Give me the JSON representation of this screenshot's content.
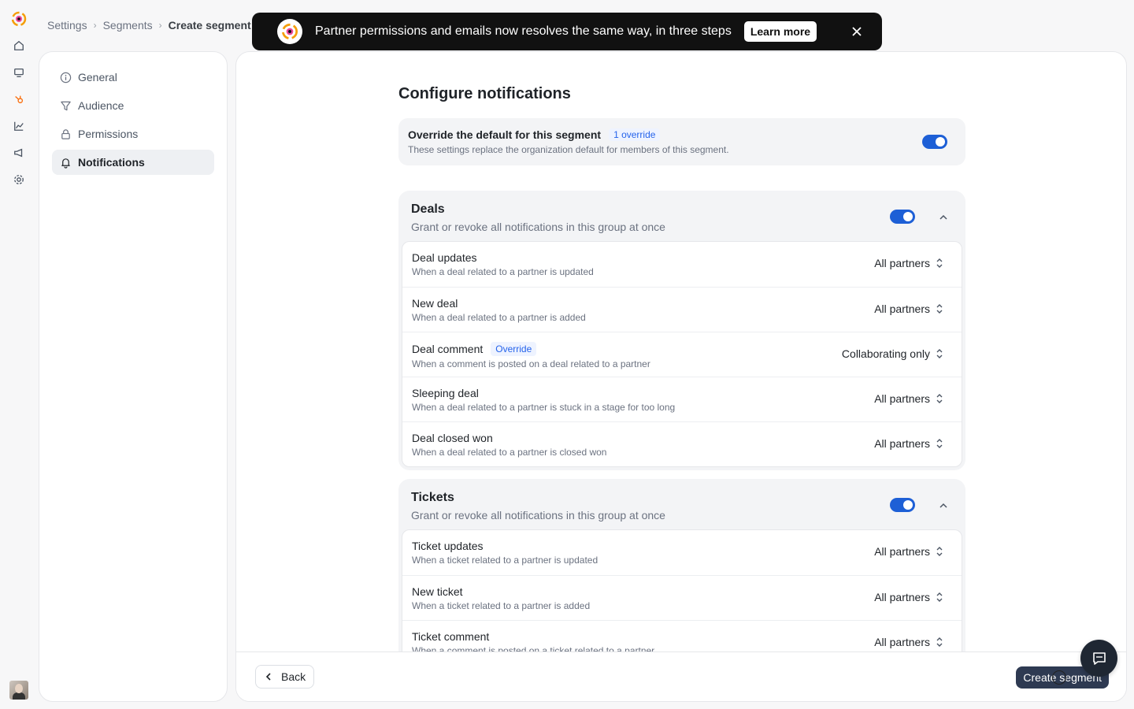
{
  "breadcrumb": {
    "items": [
      "Settings",
      "Segments"
    ],
    "current": "Create segment"
  },
  "banner": {
    "text": "Partner permissions and emails now resolves the same way, in three steps",
    "learn_more": "Learn more"
  },
  "sidenav": {
    "items": [
      {
        "label": "General",
        "icon": "info-icon"
      },
      {
        "label": "Audience",
        "icon": "filter-icon"
      },
      {
        "label": "Permissions",
        "icon": "lock-icon"
      },
      {
        "label": "Notifications",
        "icon": "bell-icon",
        "active": true
      }
    ]
  },
  "main": {
    "title": "Configure notifications",
    "override": {
      "title": "Override the default for this segment",
      "badge": "1 override",
      "description": "These settings replace the organization default for members of this segment.",
      "enabled": true
    },
    "groups": [
      {
        "title": "Deals",
        "subtitle": "Grant or revoke all notifications in this group at once",
        "enabled": true,
        "items": [
          {
            "title": "Deal updates",
            "desc": "When a deal related to a partner is updated",
            "value": "All partners"
          },
          {
            "title": "New deal",
            "desc": "When a deal related to a partner is added",
            "value": "All partners"
          },
          {
            "title": "Deal comment",
            "badge": "Override",
            "desc": "When a comment is posted on a deal related to a partner",
            "value": "Collaborating only"
          },
          {
            "title": "Sleeping deal",
            "desc": "When a deal related to a partner is stuck in a stage for too long",
            "value": "All partners"
          },
          {
            "title": "Deal closed won",
            "desc": "When a deal related to a partner is closed won",
            "value": "All partners"
          }
        ]
      },
      {
        "title": "Tickets",
        "subtitle": "Grant or revoke all notifications in this group at once",
        "enabled": true,
        "items": [
          {
            "title": "Ticket updates",
            "desc": "When a ticket related to a partner is updated",
            "value": "All partners"
          },
          {
            "title": "New ticket",
            "desc": "When a ticket related to a partner is added",
            "value": "All partners"
          },
          {
            "title": "Ticket comment",
            "desc": "When a comment is posted on a ticket related to a partner",
            "value": "All partners"
          }
        ]
      }
    ]
  },
  "footer": {
    "back": "Back",
    "create": "Create segment"
  },
  "colors": {
    "accent": "#1d5fd6",
    "primary_button": "#2e3a52",
    "banner_bg": "#111111"
  }
}
